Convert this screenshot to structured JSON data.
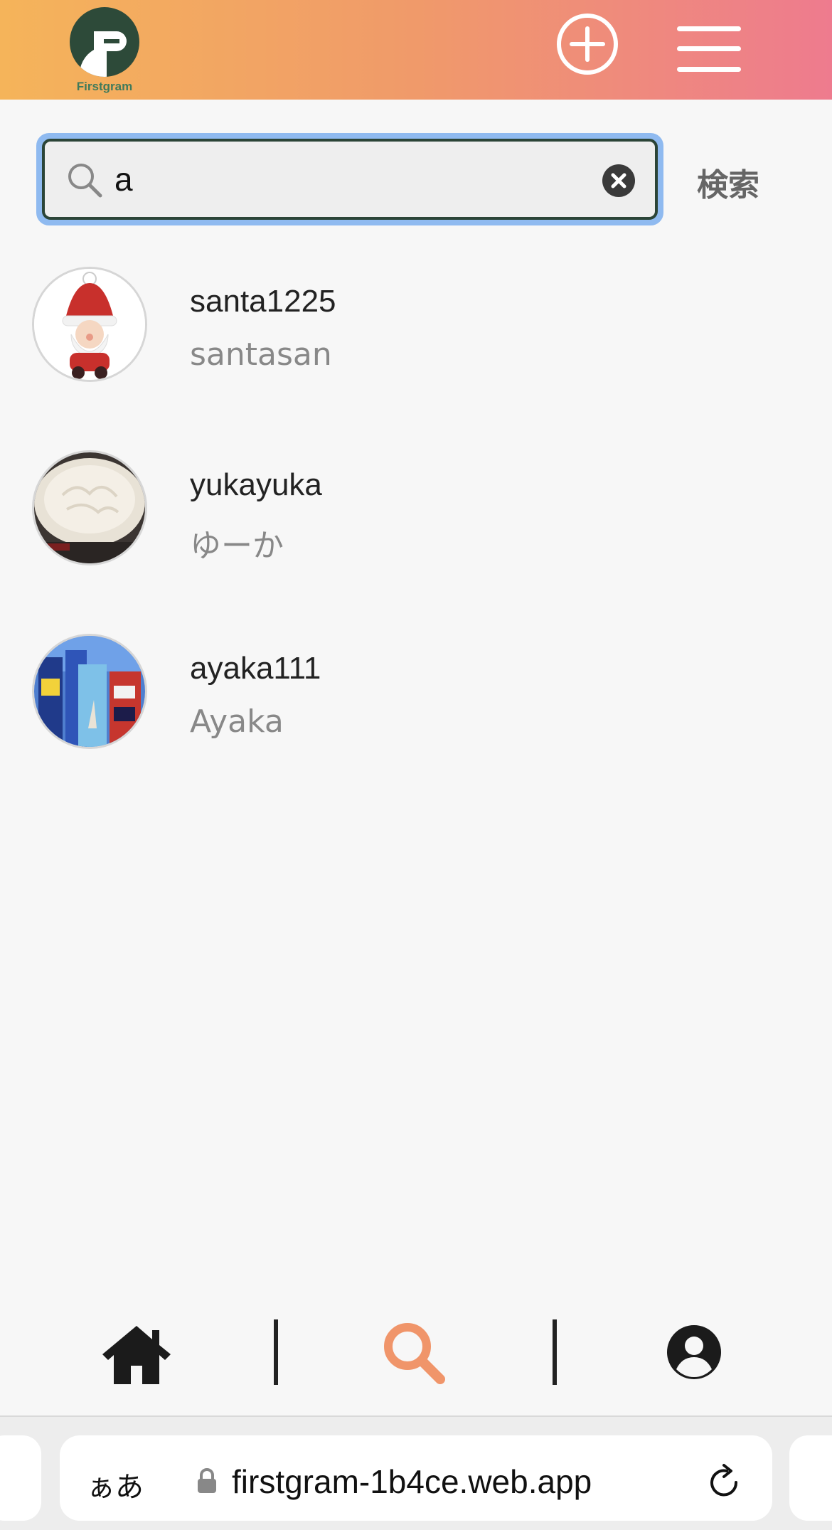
{
  "app": {
    "name": "Firstgram"
  },
  "header": {
    "logo_text": "Firstgram",
    "add_icon": "plus-circle-icon",
    "menu_icon": "hamburger-menu-icon"
  },
  "search": {
    "value": "a",
    "submit_label": "検索",
    "search_icon": "search-icon",
    "clear_icon": "clear-icon"
  },
  "results": [
    {
      "username": "santa1225",
      "display_name": "santasan",
      "avatar": "santa-avatar"
    },
    {
      "username": "yukayuka",
      "display_name": "ゆーか",
      "avatar": "whipped-cream-avatar"
    },
    {
      "username": "ayaka111",
      "display_name": "Ayaka",
      "avatar": "city-billboard-avatar"
    }
  ],
  "bottom_nav": {
    "items": [
      {
        "icon": "home-icon",
        "active": false
      },
      {
        "icon": "search-icon",
        "active": true
      },
      {
        "icon": "profile-icon",
        "active": false
      }
    ],
    "active_color": "#f0956a"
  },
  "browser": {
    "text_size_label": "ぁあ",
    "url": "firstgram-1b4ce.web.app",
    "lock_icon": "lock-icon",
    "reload_icon": "reload-icon"
  },
  "colors": {
    "header_gradient_start": "#f5b45a",
    "header_gradient_end": "#ee7b8e",
    "logo_green": "#2d4a39",
    "search_focus": "#8fbaf0"
  }
}
